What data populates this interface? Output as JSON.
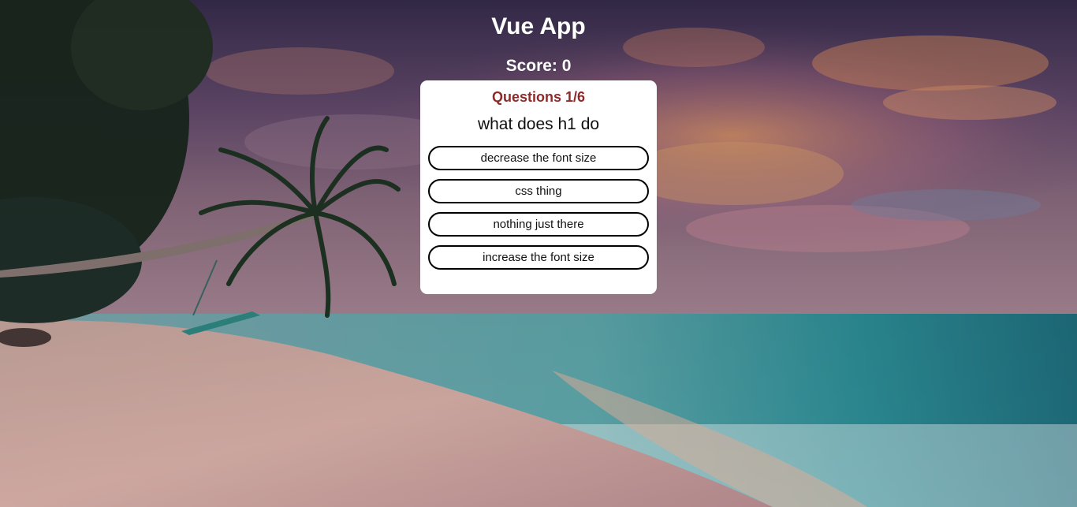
{
  "app": {
    "title": "Vue App",
    "score_label": "Score: 0"
  },
  "quiz": {
    "progress_label": "Questions 1/6",
    "question": "what does h1 do",
    "options": [
      {
        "label": "decrease the font size"
      },
      {
        "label": "css thing"
      },
      {
        "label": "nothing just there"
      },
      {
        "label": "increase the font size"
      }
    ]
  },
  "colors": {
    "progress_text": "#8e2a2a",
    "card_bg": "#ffffff",
    "heading_text": "#ffffff"
  },
  "background": {
    "image": "tropical beach at sunset with leaning palm tree and swing"
  }
}
